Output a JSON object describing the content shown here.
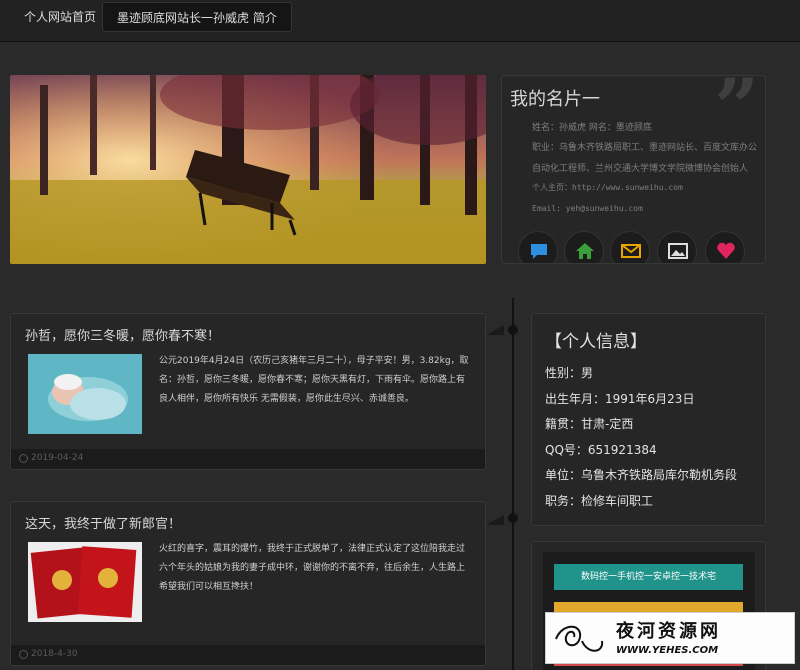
{
  "nav": {
    "home": "个人网站首页",
    "about": "墨迹顾底网站长一孙威虎 简介"
  },
  "card": {
    "title": "我的名片一",
    "line1": "姓名：孙威虎 网名：墨迹顾底",
    "line2": "职业：乌鲁木齐铁路局职工、墨迹网站长、百度文库办公",
    "line3": "自动化工程师、兰州交通大学博文学院微博协会创始人",
    "line4": "个人主页：http://www.sunweihu.com",
    "line5": "Email: yeh@sunweihu.com",
    "icons": [
      "chat-icon",
      "home-icon",
      "mail-icon",
      "image-icon",
      "heart-icon"
    ],
    "icon_colors": [
      "#2d8fe0",
      "#3aa13a",
      "#e8a400",
      "#dddddd",
      "#e0245e"
    ]
  },
  "posts": [
    {
      "title": "孙哲，愿你三冬暖，愿你春不寒！",
      "text": "公元2019年4月24日（农历己亥猪年三月二十），母子平安！男，3.82kg，取名：孙哲，愿你三冬暖，愿你春不寒；愿你天黑有灯，下雨有伞。愿你路上有良人相伴，愿你所有快乐 无需假装，愿你此生尽兴、赤诚善良。",
      "date": "2019-04-24"
    },
    {
      "title": "这天，我终于做了新郎官！",
      "text": "火红的喜字，震耳的爆竹，我终于正式脱单了，法律正式认定了这位陪我走过六个年头的姑娘为我的妻子成中环，谢谢你的不离不弃，往后余生，人生路上希望我们可以相互搀扶！",
      "date": "2018-4-30"
    }
  ],
  "info": {
    "title": "【个人信息】",
    "rows": [
      "性别：男",
      "出生年月：1991年6月23日",
      "籍贯：甘肃-定西",
      "QQ号：651921384",
      "单位：乌鲁木齐铁路局库尔勒机务段",
      "职务：检修车间职工"
    ]
  },
  "links": [
    "数码控一手机控一安卓控一技术宅",
    "",
    ""
  ],
  "watermark": {
    "title": "夜河资源网",
    "url": "WWW.YEHES.COM"
  }
}
